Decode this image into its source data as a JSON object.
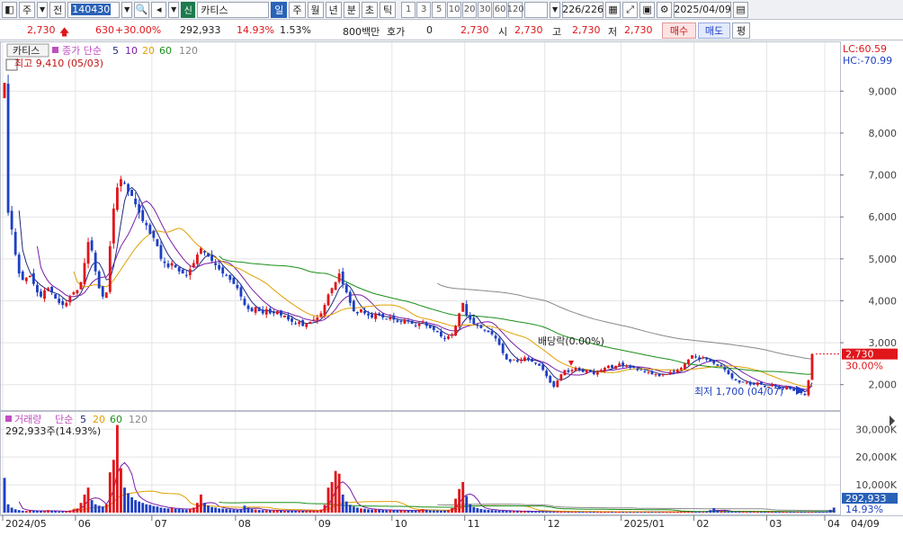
{
  "toolbar": {
    "market": "주",
    "prev_label": "전",
    "stock_code": "140430",
    "new_badge": "신",
    "stock_name": "카티스",
    "periods": [
      "일",
      "주",
      "월",
      "년",
      "분",
      "초",
      "틱"
    ],
    "intervals": [
      "1",
      "3",
      "5",
      "10",
      "20",
      "30",
      "60",
      "120"
    ],
    "count": "226/226",
    "date": "2025/04/09"
  },
  "quote": {
    "price": "2,730",
    "change": "630",
    "change_pct": "+30.00%",
    "volume": "292,933",
    "volume_pct": "14.93%",
    "turnover_pct": "1.53%",
    "amount": "800백만",
    "hoga_label": "호가",
    "hoga_value": "0",
    "hoga_price": "2,730",
    "open_label": "시",
    "open": "2,730",
    "high_label": "고",
    "high": "2,730",
    "low_label": "저",
    "low": "2,730",
    "buy_label": "매수",
    "sell_label": "매도",
    "avg_label": "평"
  },
  "price_panel": {
    "legend_name": "카티스",
    "legend_ma_label": "종가 단순",
    "ma_periods": [
      "5",
      "10",
      "20",
      "60",
      "120"
    ],
    "max_label": "최고 9,410 (05/03)",
    "min_label": "최저 1,700 (04/07)",
    "event_label": "배당락(0.00%)",
    "lc_label": "LC:60.59",
    "hc_label": "HC:-70.99",
    "current_price": "2,730",
    "current_pct": "30.00%"
  },
  "volume_panel": {
    "legend_name": "거래량",
    "legend_ma_label": "단순",
    "ma_periods": [
      "5",
      "20",
      "60",
      "120"
    ],
    "current_label": "292,933주(14.93%)",
    "current_value": "292,933",
    "current_pct": "14.93%"
  },
  "x_labels": [
    "2024/05",
    "06",
    "07",
    "08",
    "09",
    "10",
    "11",
    "12",
    "2025/01",
    "02",
    "03",
    "04",
    "04/09"
  ],
  "colors": {
    "up": "#e0161b",
    "down": "#1d3fc4",
    "ma5": "#1f2a80",
    "ma10": "#7a1ea8",
    "ma20": "#e0a000",
    "ma60": "#1a8f1a",
    "ma120": "#888888",
    "grid": "#e4e4e4",
    "tag_bg": "#e0161b",
    "vol_tag_bg": "#2a62b8"
  },
  "chart_data": {
    "type": "candlestick",
    "price_axis": {
      "ticks": [
        "9,000",
        "8,000",
        "7,000",
        "6,000",
        "5,000",
        "4,000",
        "3,000",
        "2,000"
      ],
      "ylim": [
        1500,
        9500
      ]
    },
    "volume_axis": {
      "ticks": [
        "30,000K",
        "20,000K",
        "10,000K"
      ],
      "ylim": [
        0,
        33000
      ]
    },
    "x_ticks": [
      "2024/05",
      "06",
      "07",
      "08",
      "09",
      "10",
      "11",
      "12",
      "2025/01",
      "02",
      "03",
      "04",
      "04/09"
    ],
    "x_tick_index": [
      0,
      20,
      41,
      64,
      86,
      107,
      127,
      149,
      170,
      190,
      210,
      229,
      225
    ],
    "close": [
      9200,
      6100,
      5700,
      5100,
      4650,
      4500,
      4550,
      4600,
      4400,
      4200,
      4100,
      4250,
      4300,
      4200,
      4050,
      3950,
      3900,
      3950,
      4100,
      4200,
      4250,
      4450,
      4900,
      5400,
      5200,
      4700,
      4300,
      4100,
      4200,
      5300,
      6200,
      6700,
      6900,
      6800,
      6600,
      6500,
      6300,
      6100,
      5900,
      5800,
      5600,
      5500,
      5300,
      5000,
      4900,
      4800,
      4900,
      4800,
      4700,
      4650,
      4600,
      4750,
      4900,
      5100,
      5250,
      5150,
      5050,
      4950,
      4850,
      4750,
      4650,
      4600,
      4500,
      4400,
      4300,
      4100,
      3900,
      3800,
      3750,
      3850,
      3750,
      3700,
      3800,
      3700,
      3700,
      3750,
      3650,
      3650,
      3550,
      3500,
      3450,
      3500,
      3400,
      3450,
      3500,
      3550,
      3600,
      3700,
      3900,
      4150,
      4300,
      4450,
      4650,
      4400,
      4200,
      3950,
      3750,
      3700,
      3800,
      3700,
      3650,
      3600,
      3700,
      3650,
      3600,
      3550,
      3600,
      3550,
      3500,
      3500,
      3550,
      3500,
      3450,
      3400,
      3450,
      3500,
      3400,
      3350,
      3300,
      3250,
      3150,
      3100,
      3150,
      3200,
      3400,
      3700,
      3950,
      3650,
      3550,
      3450,
      3400,
      3350,
      3300,
      3250,
      3200,
      3100,
      2950,
      2750,
      2600,
      2550,
      2600,
      2550,
      2600,
      2650,
      2600,
      2550,
      2500,
      2450,
      2350,
      2200,
      2050,
      1950,
      2100,
      2250,
      2350,
      2300,
      2350,
      2400,
      2350,
      2300,
      2350,
      2300,
      2250,
      2300,
      2350,
      2400,
      2450,
      2400,
      2450,
      2500,
      2450,
      2450,
      2400,
      2400,
      2350,
      2350,
      2300,
      2300,
      2250,
      2250,
      2200,
      2250,
      2250,
      2300,
      2300,
      2350,
      2400,
      2500,
      2600,
      2700,
      2650,
      2600,
      2650,
      2600,
      2550,
      2500,
      2450,
      2450,
      2350,
      2250,
      2150,
      2100,
      2050,
      2050,
      2050,
      2000,
      2000,
      2050,
      2000,
      1950,
      1950,
      2000,
      1950,
      1900,
      1900,
      1950,
      1900,
      1850,
      1850,
      1800,
      1750,
      2100,
      2730
    ],
    "volume_k": [
      12500,
      3000,
      1800,
      1200,
      900,
      700,
      600,
      800,
      700,
      600,
      500,
      700,
      900,
      600,
      500,
      400,
      450,
      500,
      800,
      1200,
      1500,
      3500,
      6500,
      9000,
      4500,
      3000,
      2500,
      2200,
      3000,
      14500,
      19000,
      31500,
      16000,
      9000,
      7000,
      5500,
      4500,
      4000,
      3500,
      3000,
      2800,
      2400,
      2200,
      1800,
      1600,
      1500,
      1600,
      1400,
      1300,
      1200,
      1100,
      1400,
      1800,
      3500,
      6500,
      3500,
      2500,
      2000,
      1800,
      1500,
      1400,
      1300,
      1200,
      1100,
      1000,
      1200,
      2500,
      1800,
      1300,
      1100,
      1000,
      900,
      900,
      800,
      800,
      800,
      700,
      700,
      700,
      650,
      650,
      700,
      650,
      650,
      700,
      750,
      800,
      1100,
      2800,
      9000,
      11000,
      15000,
      14000,
      6500,
      4000,
      2800,
      2200,
      1800,
      1500,
      1400,
      1200,
      1100,
      1100,
      1000,
      950,
      900,
      900,
      850,
      850,
      800,
      800,
      780,
      760,
      750,
      900,
      1200,
      1000,
      850,
      800,
      750,
      700,
      800,
      900,
      1600,
      5000,
      8500,
      11000,
      6000,
      3000,
      2000,
      1600,
      1300,
      1100,
      1000,
      900,
      800,
      750,
      700,
      650,
      600,
      550,
      520,
      500,
      480,
      460,
      450,
      440,
      430,
      420,
      410,
      400,
      390,
      380,
      370,
      360,
      350,
      340,
      340,
      330,
      330,
      320,
      320,
      310,
      310,
      300,
      300,
      300,
      300,
      300,
      300,
      300,
      300,
      300,
      300,
      300,
      300,
      300,
      300,
      300,
      300,
      300,
      300,
      300,
      300,
      300,
      300,
      300,
      300,
      300,
      300,
      320,
      350,
      380,
      420,
      900,
      1600,
      700,
      500,
      450,
      420,
      400,
      380,
      360,
      350,
      340,
      330,
      320,
      310,
      300,
      300,
      300,
      300,
      300,
      300,
      300,
      300,
      300,
      300,
      300,
      300,
      300,
      300,
      300,
      300,
      300,
      300,
      400,
      1000,
      1800
    ]
  }
}
